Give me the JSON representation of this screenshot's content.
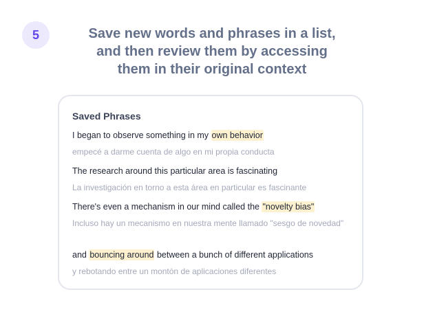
{
  "step": {
    "number": "5"
  },
  "headline": {
    "line1": "Save new words and phrases in a list,",
    "line2": "and then review them by accessing",
    "line3": "them in their original context"
  },
  "saved_phrases": {
    "title": "Saved Phrases",
    "items": [
      {
        "before": "I began to observe something in my ",
        "highlight": "own behavior",
        "after": "",
        "translation": "empecé a darme cuenta de algo en mi propia conducta"
      },
      {
        "before": "The research around this particular area is fascinating",
        "highlight": "",
        "after": "",
        "translation": "La investigación en torno a esta área en particular es fascinante"
      },
      {
        "before": "There's even a mechanism in our mind called the ",
        "highlight": "\"novelty bias\"",
        "after": "",
        "translation": "Incluso hay un mecanismo en nuestra mente llamado \"sesgo de novedad\""
      },
      {
        "before": "and ",
        "highlight": "bouncing around",
        "after": " between a bunch of different applications",
        "translation": "y rebotando entre un montón de aplicaciones diferentes"
      }
    ]
  },
  "colors": {
    "accent": "#6246ea",
    "badge_bg": "#ece9fd",
    "highlight_bg": "#fdf1cf",
    "headline_text": "#64708a",
    "translation_text": "#a4a9ba"
  }
}
